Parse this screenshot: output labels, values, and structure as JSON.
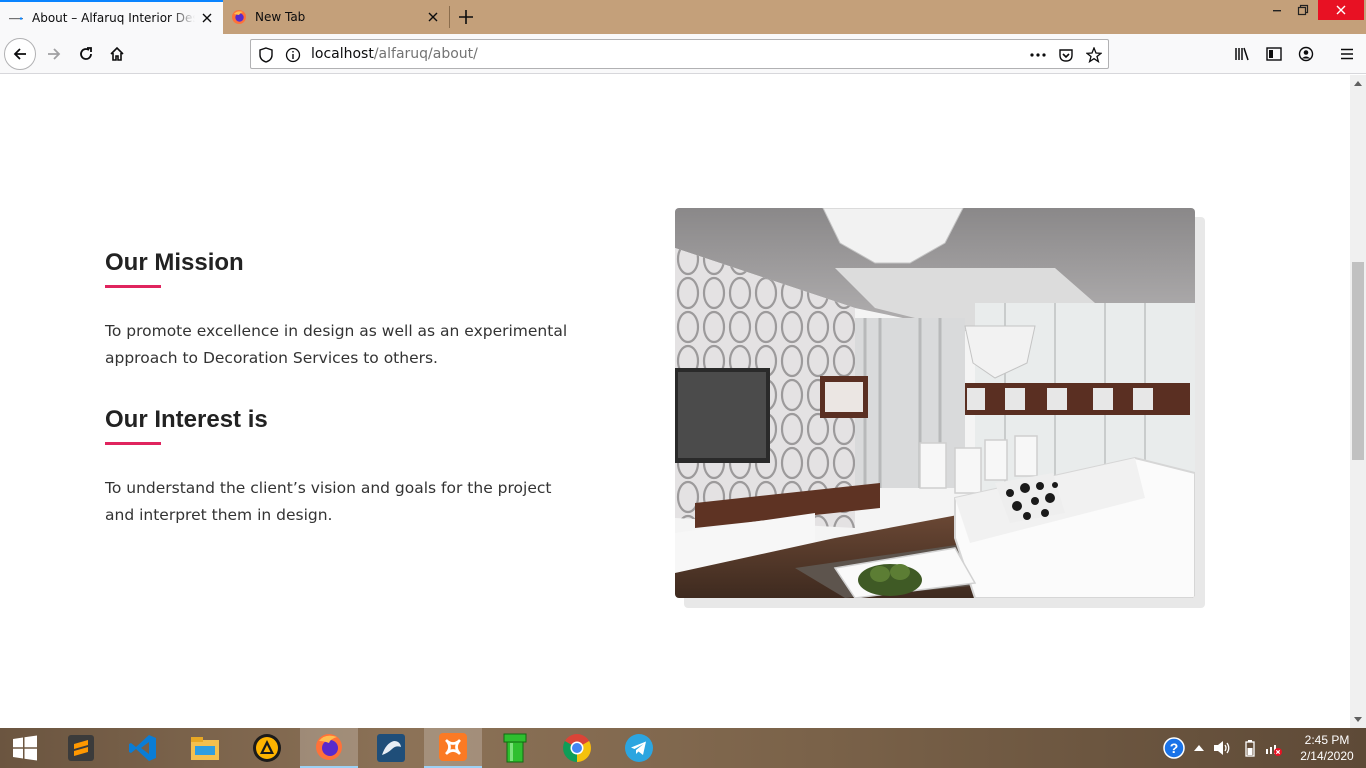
{
  "browser": {
    "tabs": [
      {
        "title": "About – Alfaruq Interior Design",
        "active": true
      },
      {
        "title": "New Tab",
        "active": false
      }
    ],
    "url": {
      "host": "localhost",
      "path": "/alfaruq/about/"
    },
    "accent_color": "#0a84ff",
    "titlebar_color": "#c4a07a"
  },
  "page": {
    "mission": {
      "heading": "Our Mission",
      "text": "To promote excellence in design as well as an experimental approach to Decoration Services to others."
    },
    "interest": {
      "heading": "Our Interest is",
      "text": "To understand the client’s vision and goals for the project and interpret them in design."
    },
    "accent_color": "#e0245e",
    "image": {
      "subject": "modern-living-room-interior-photo"
    }
  },
  "taskbar": {
    "apps": [
      {
        "name": "sublime-text-icon"
      },
      {
        "name": "vscode-icon"
      },
      {
        "name": "file-explorer-icon"
      },
      {
        "name": "aimp-icon"
      },
      {
        "name": "firefox-icon",
        "active": true
      },
      {
        "name": "mysql-workbench-icon"
      },
      {
        "name": "xampp-icon",
        "active": true
      },
      {
        "name": "green-pipe-icon"
      },
      {
        "name": "chrome-icon"
      },
      {
        "name": "telegram-icon"
      }
    ],
    "clock": {
      "time": "2:45 PM",
      "date": "2/14/2020"
    }
  }
}
